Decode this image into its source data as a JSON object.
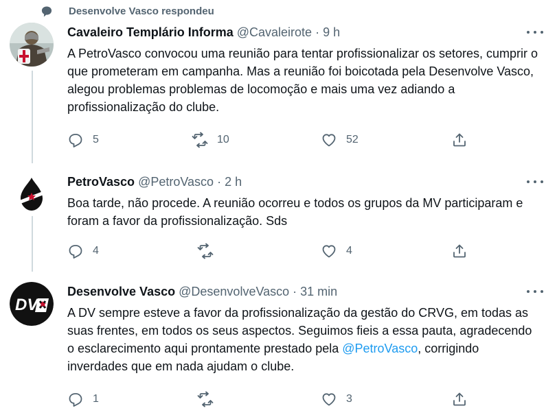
{
  "social_context": {
    "icon": "speech-bubble-icon",
    "text": "Desenvolve Vasco respondeu"
  },
  "tweets": [
    {
      "name": "Cavaleiro Templário Informa",
      "handle": "@Cavaleirote",
      "sep": " · ",
      "time": "9 h",
      "body": "A PetroVasco convocou uma reunião para tentar profissionalizar os setores, cumprir o que prometeram em campanha. Mas a reunião foi boicotada pela Desenvolve Vasco, alegou problemas problemas de locomoção e mais uma vez adiando a profissionalização do clube.",
      "replies": "5",
      "retweets": "10",
      "likes": "52"
    },
    {
      "name": "PetroVasco",
      "handle": "@PetroVasco",
      "sep": " · ",
      "time": "2 h",
      "body": "Boa tarde, não procede. A reunião ocorreu e todos os grupos da MV participaram e foram a favor da profissionalização. Sds",
      "replies": "4",
      "retweets": "",
      "likes": "4"
    },
    {
      "name": "Desenvolve Vasco",
      "handle": "@DesenvolveVasco",
      "sep": " · ",
      "time": "31 min",
      "body_pre": "A DV sempre esteve a favor da profissionalização da gestão do CRVG, em todas as suas frentes, em todos os seus aspectos. Seguimos fieis a essa pauta, agradecendo o esclarecimento aqui prontamente prestado pela",
      "mention": "@PetroVasco",
      "body_post": ", corrigindo inverdades que em nada ajudam o clube.",
      "replies": "1",
      "retweets": "",
      "likes": "3"
    }
  ],
  "avatars": {
    "dv_logo_text": "DV"
  },
  "colors": {
    "text": "#0f1419",
    "secondary": "#536471",
    "link": "#1d9bf0",
    "thread_line": "#cfd9de"
  }
}
